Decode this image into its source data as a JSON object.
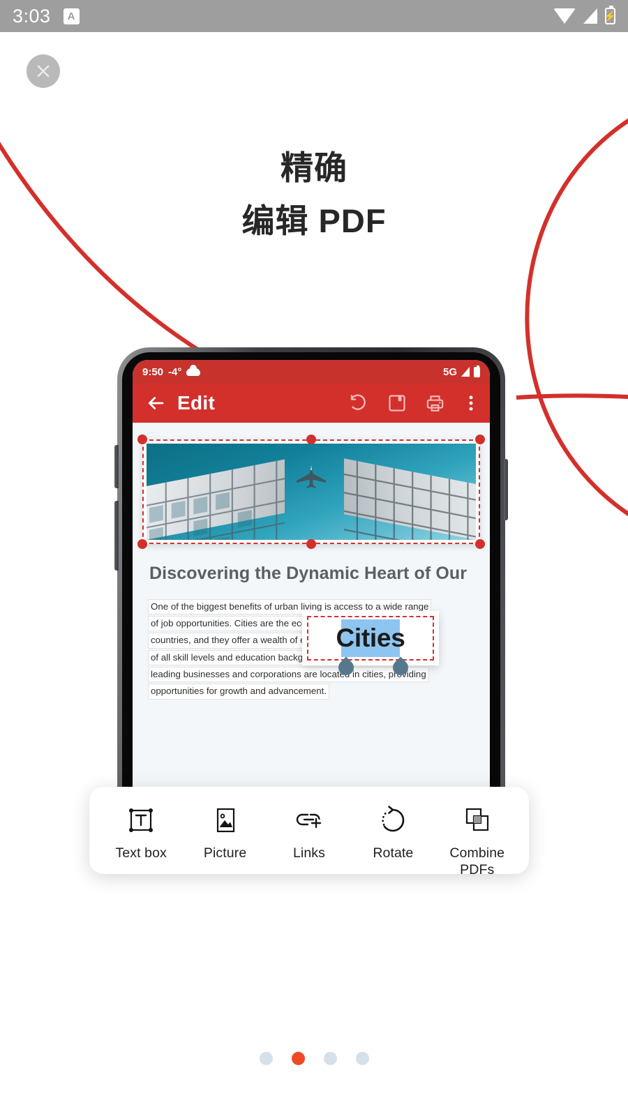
{
  "status_bar": {
    "time": "3:03",
    "app_badge": "A",
    "icons": [
      "wifi-icon",
      "signal-icon",
      "battery-charging-icon"
    ],
    "background": "#9e9e9e"
  },
  "close_button": {
    "label": "×",
    "icon": "close-icon"
  },
  "headline": {
    "line1": "精确",
    "line2": "编辑 PDF"
  },
  "decor": {
    "color": "#d3302b"
  },
  "phone": {
    "status": {
      "time": "9:50",
      "temperature": "-4°",
      "weather_icon": "cloud-icon",
      "network": "5G",
      "icons": [
        "signal-icon",
        "battery-icon"
      ]
    },
    "toolbar": {
      "back_icon": "back-arrow-icon",
      "title": "Edit",
      "actions": [
        {
          "name": "undo",
          "icon": "undo-icon"
        },
        {
          "name": "save",
          "icon": "save-floppy-icon"
        },
        {
          "name": "print",
          "icon": "printer-icon"
        },
        {
          "name": "more",
          "icon": "more-vertical-icon"
        }
      ]
    },
    "document": {
      "image_alt": "airplane-between-buildings",
      "heading": "Discovering the Dynamic Heart of Our",
      "magnifier": {
        "text": "Cities",
        "highlight_color": "#8ec5f0",
        "handle_color": "#55788c"
      },
      "body_lines": [
        "One of the biggest benefits of urban living is access to a wide range",
        "of job opportunities. Cities are the economic engines of most",
        "countries, and they offer a wealth of employment options for people",
        "of all skill levels and education backgrounds. Many of the world's",
        "leading businesses and corporations are located in cities, providing",
        "opportunities for growth and advancement."
      ]
    },
    "selection_color": "#d3302b",
    "toolbar_color": "#d32f2b"
  },
  "action_bar": {
    "items": [
      {
        "label": "Text box",
        "icon": "text-box-icon"
      },
      {
        "label": "Picture",
        "icon": "picture-icon"
      },
      {
        "label": "Links",
        "icon": "link-add-icon"
      },
      {
        "label": "Rotate",
        "icon": "rotate-icon"
      },
      {
        "label": "Combine PDFs",
        "icon": "combine-pdfs-icon"
      }
    ]
  },
  "pagination": {
    "total": 4,
    "active_index": 1,
    "active_color": "#ef4a23",
    "inactive_color": "#d5e0e8"
  }
}
